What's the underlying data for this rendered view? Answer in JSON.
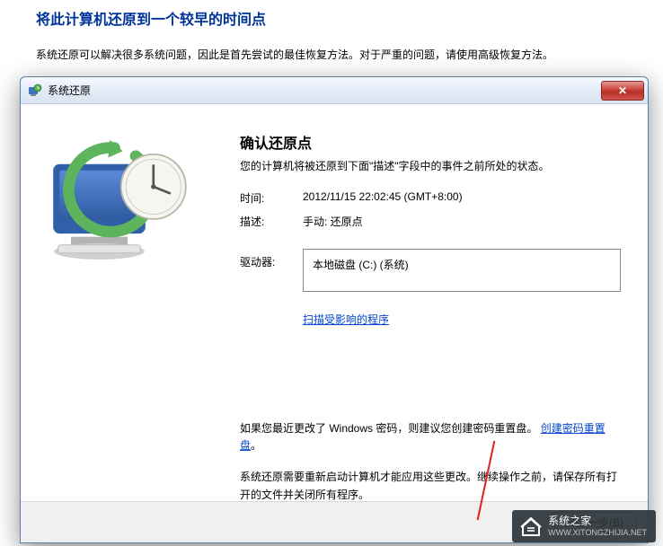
{
  "page": {
    "heading": "将此计算机还原到一个较早的时间点",
    "subtext": "系统还原可以解决很多系统问题，因此是首先尝试的最佳恢复方法。对于严重的问题，请使用高级恢复方法。"
  },
  "dialog": {
    "title": "系统还原",
    "close_glyph": "✕",
    "main_title": "确认还原点",
    "main_desc": "您的计算机将被还原到下面\"描述\"字段中的事件之前所处的状态。",
    "time_label": "时间:",
    "time_value": "2012/11/15 22:02:45 (GMT+8:00)",
    "desc_label": "描述:",
    "desc_value": "手动: 还原点",
    "drives_label": "驱动器:",
    "drives_value": "本地磁盘 (C:) (系统)",
    "scan_link": "扫描受影响的程序",
    "pw_note_pre": "如果您最近更改了 Windows 密码，则建议您创建密码重置盘。",
    "pw_link": "创建密码重置盘",
    "pw_note_suf": "。",
    "restart_note": "系统还原需要重新启动计算机才能应用这些更改。继续操作之前，请保存所有打开的文件并关闭所有程序。",
    "back_btn": "< 上一步(B)"
  },
  "watermark": {
    "name": "系统之家",
    "url": "WWW.XITONGZHIJIA.NET"
  }
}
